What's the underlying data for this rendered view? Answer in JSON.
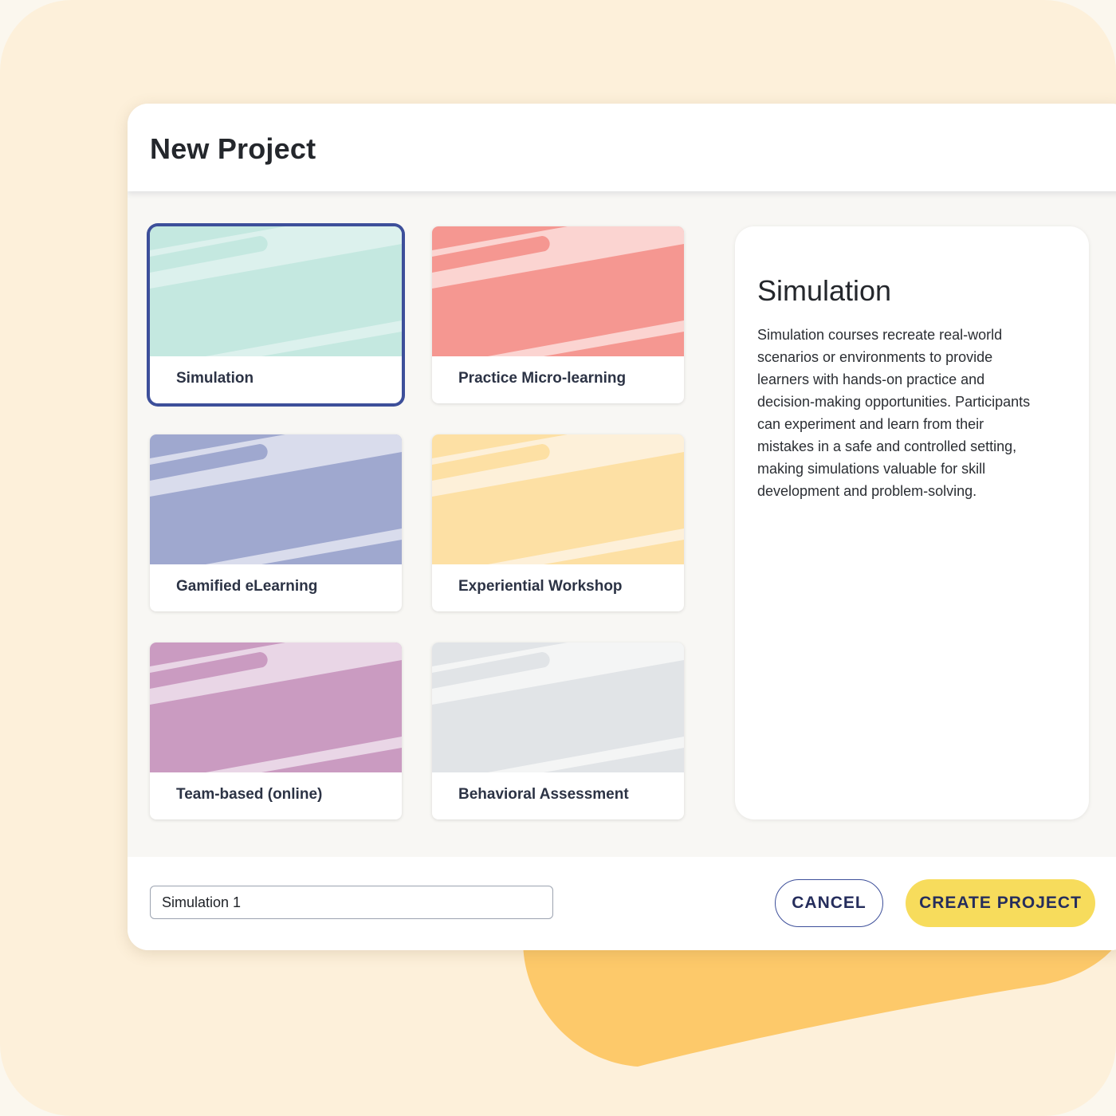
{
  "dialog": {
    "title": "New Project"
  },
  "templates": [
    {
      "label": "Simulation",
      "color": "#c4e8e0",
      "stripe": "#dcf1ed",
      "selected": true
    },
    {
      "label": "Practice Micro-learning",
      "color": "#f59791",
      "stripe": "#fbd4d1",
      "selected": false
    },
    {
      "label": "Gamified eLearning",
      "color": "#9fa8cf",
      "stripe": "#d9dcec",
      "selected": false
    },
    {
      "label": "Experiential Workshop",
      "color": "#fde0a4",
      "stripe": "#fdf0d9",
      "selected": false
    },
    {
      "label": "Team-based (online)",
      "color": "#ca9bc1",
      "stripe": "#e9d6e6",
      "selected": false
    },
    {
      "label": "Behavioral Assessment",
      "color": "#e1e4e7",
      "stripe": "#f4f5f5",
      "selected": false
    }
  ],
  "description": {
    "title": "Simulation",
    "text": "Simulation courses recreate real-world scenarios or environments to provide learners with hands-on practice and decision-making opportunities. Participants can experiment and learn from their mistakes in a safe and controlled setting, making simulations valuable for skill development and problem-solving."
  },
  "footer": {
    "project_name_value": "Simulation 1",
    "cancel_label": "CANCEL",
    "create_label": "CREATE PROJECT"
  },
  "colors": {
    "accent": "#3d4f9a",
    "primary_button": "#f7dc5c",
    "background": "#fdf0da",
    "blob": "#fdc96a"
  }
}
